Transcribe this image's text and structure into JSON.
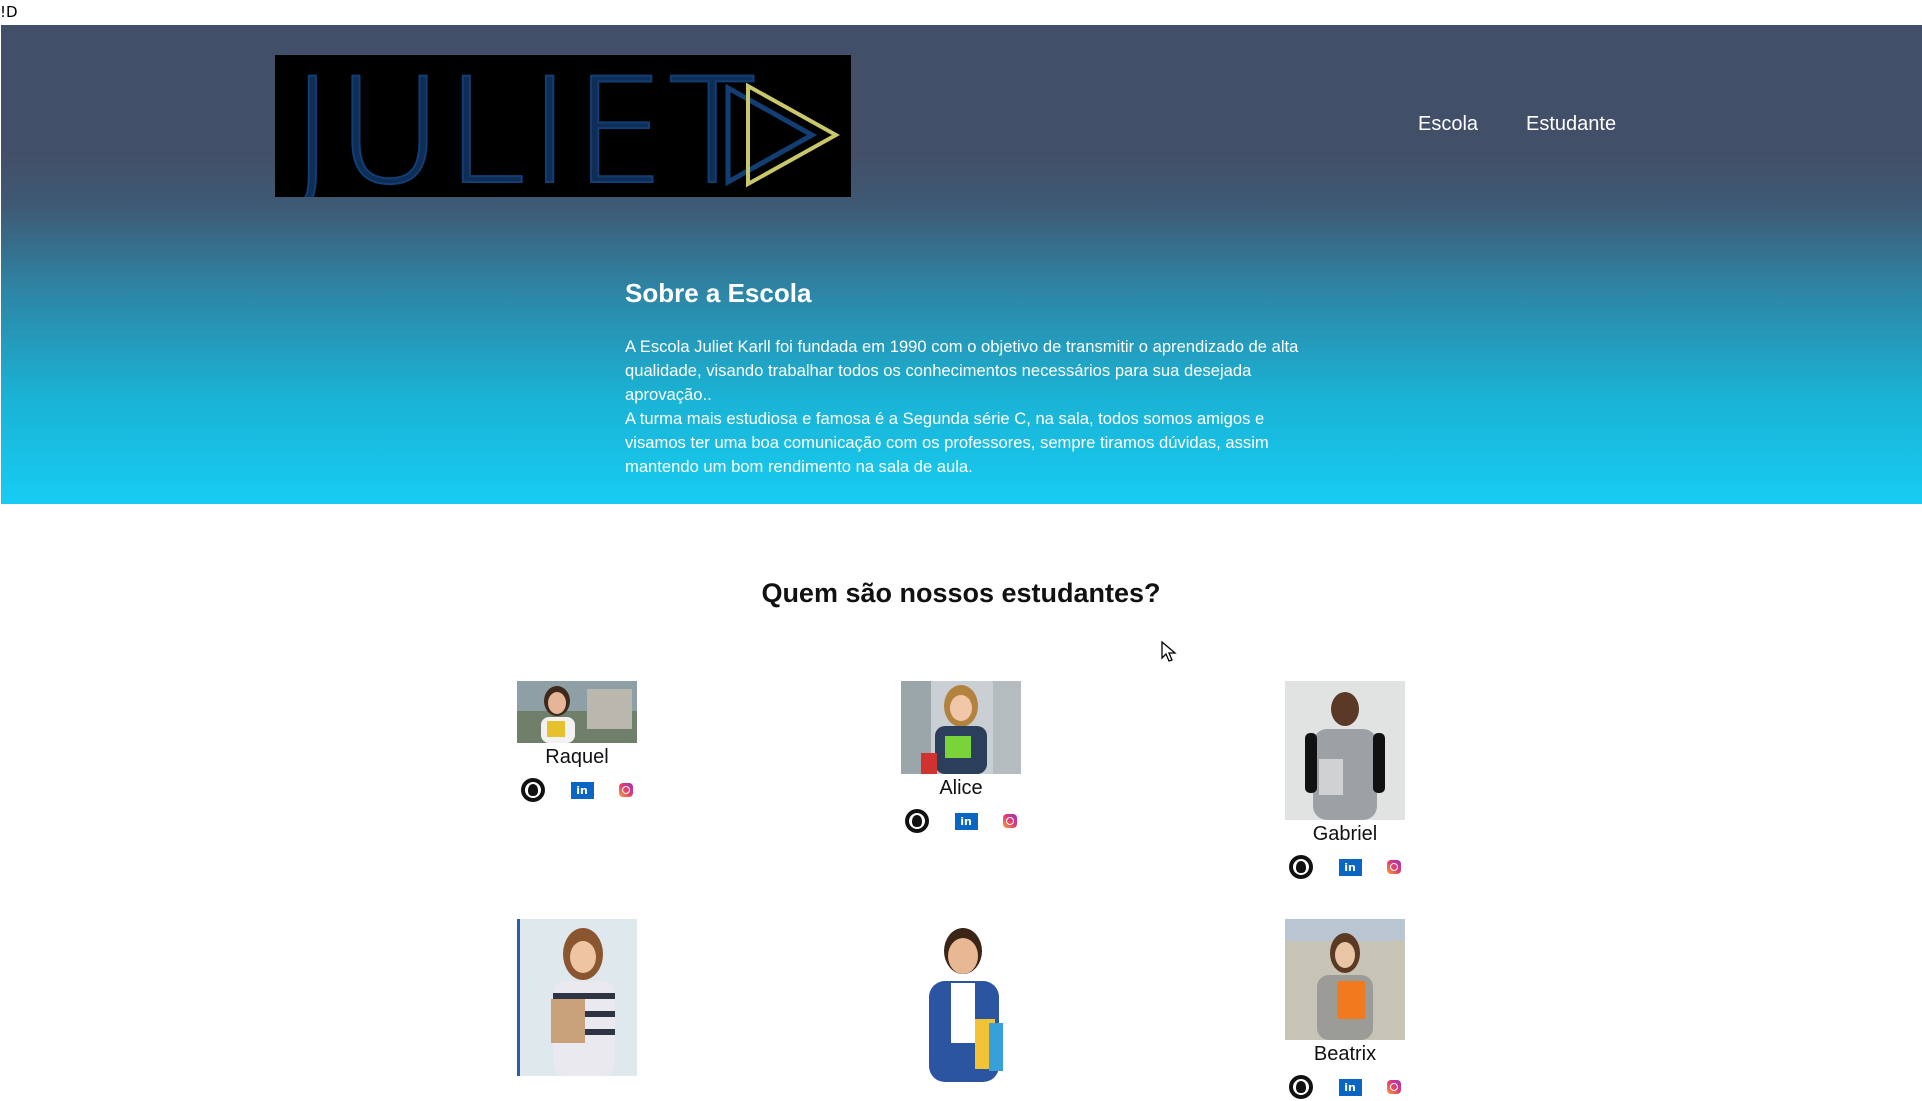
{
  "top_strip": {
    "text": "!D"
  },
  "logo": {
    "text": "JULIET"
  },
  "nav": {
    "items": [
      "Escola",
      "Estudante"
    ]
  },
  "about": {
    "title": "Sobre a Escola",
    "paragraphs": [
      "A Escola Juliet Karll foi fundada em 1990 com o objetivo de transmitir o aprendizado de alta qualidade, visando trabalhar todos os conhecimentos necessários para sua desejada aprovação..",
      "A turma mais estudiosa e famosa é a Segunda série C, na sala, todos somos amigos e visamos ter uma boa comunicação com os professores, sempre tiramos dúvidas, assim mantendo um bom rendimento na sala de aula."
    ]
  },
  "students": {
    "title": "Quem são nossos estudantes?",
    "items": [
      {
        "name": "Raquel"
      },
      {
        "name": "Alice"
      },
      {
        "name": "Gabriel"
      },
      {
        "name": ""
      },
      {
        "name": ""
      },
      {
        "name": "Beatrix"
      }
    ],
    "social_icons": [
      "github-icon",
      "linkedin-icon",
      "instagram-icon"
    ],
    "linkedin_text": "in"
  },
  "colors": {
    "hero_top": "#424f68",
    "hero_bottom": "#17ccf3",
    "logo_text": "#123e73",
    "play_outline": "#c8c86a",
    "linkedin": "#0a66c2"
  }
}
